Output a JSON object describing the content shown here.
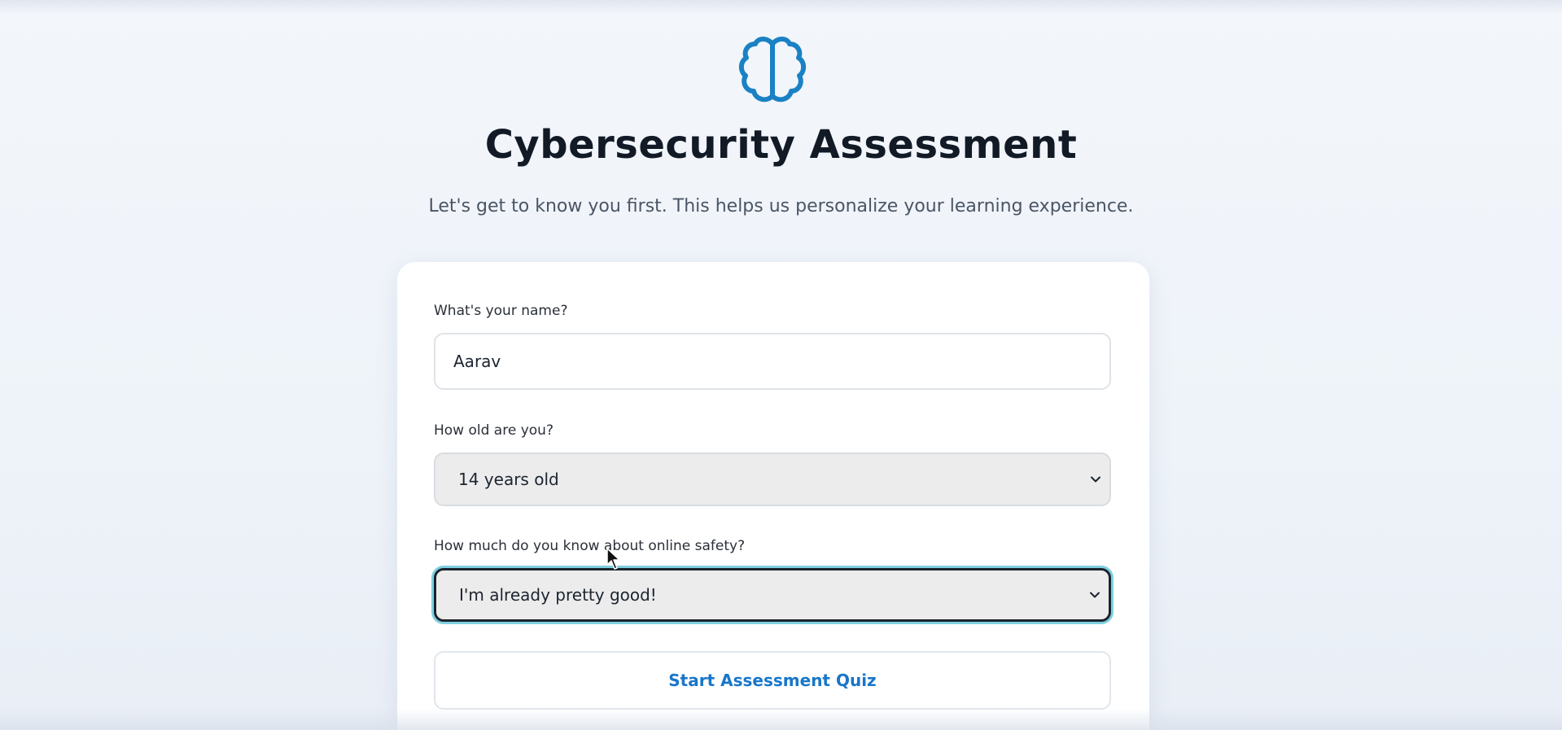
{
  "header": {
    "logo_icon": "brain-icon",
    "title": "Cybersecurity Assessment",
    "subtitle": "Let's get to know you first. This helps us personalize your learning experience."
  },
  "form": {
    "name": {
      "label": "What's your name?",
      "value": "Aarav"
    },
    "age": {
      "label": "How old are you?",
      "selected": "14 years old"
    },
    "knowledge": {
      "label": "How much do you know about online safety?",
      "selected": "I'm already pretty good!"
    },
    "submit_label": "Start Assessment Quiz"
  },
  "colors": {
    "accent": "#1976c9",
    "logo": "#1a82c4",
    "focus_ring": "#7fd0e0"
  }
}
